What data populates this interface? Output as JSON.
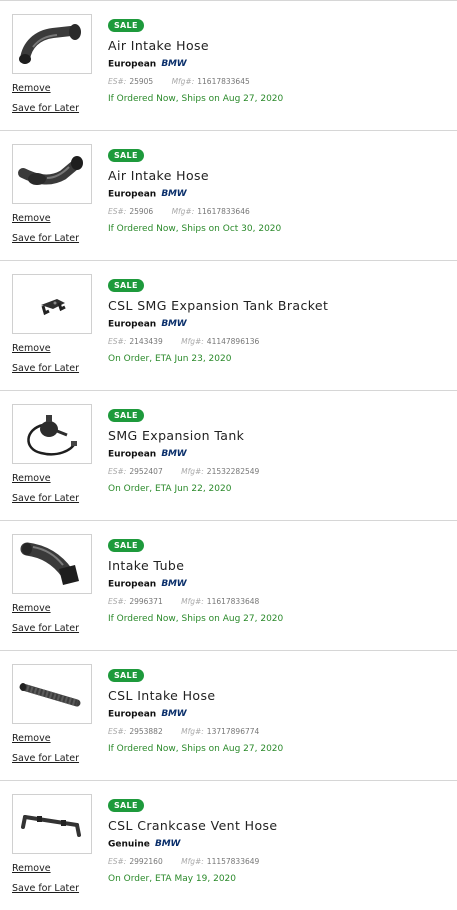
{
  "labels": {
    "sale": "SALE",
    "remove": "Remove",
    "save_for_later": "Save for Later",
    "es_label": "ES#:",
    "mfg_label": "Mfg#:"
  },
  "brand_logo_text": "BMW",
  "colors": {
    "sale_badge": "#1e9a3c",
    "ship_text": "#2b8a2b"
  },
  "items": [
    {
      "title": "Air Intake Hose",
      "brand": "European",
      "es": "25905",
      "mfg": "11617833645",
      "ship": "If Ordered Now, Ships on Aug 27, 2020",
      "image": "air-intake-hose-image"
    },
    {
      "title": "Air Intake Hose",
      "brand": "European",
      "es": "25906",
      "mfg": "11617833646",
      "ship": "If Ordered Now, Ships on Oct 30, 2020",
      "image": "air-intake-hose-image"
    },
    {
      "title": "CSL SMG Expansion Tank Bracket",
      "brand": "European",
      "es": "2143439",
      "mfg": "41147896136",
      "ship": "On Order, ETA Jun 23, 2020",
      "image": "bracket-image"
    },
    {
      "title": "SMG Expansion Tank",
      "brand": "European",
      "es": "2952407",
      "mfg": "21532282549",
      "ship": "On Order, ETA Jun 22, 2020",
      "image": "expansion-tank-image"
    },
    {
      "title": "Intake Tube",
      "brand": "European",
      "es": "2996371",
      "mfg": "11617833648",
      "ship": "If Ordered Now, Ships on Aug 27, 2020",
      "image": "intake-tube-image"
    },
    {
      "title": "CSL Intake Hose",
      "brand": "European",
      "es": "2953882",
      "mfg": "13717896774",
      "ship": "If Ordered Now, Ships on Aug 27, 2020",
      "image": "intake-hose-image"
    },
    {
      "title": "CSL Crankcase Vent Hose",
      "brand": "Genuine",
      "es": "2992160",
      "mfg": "11157833649",
      "ship": "On Order, ETA May 19, 2020",
      "image": "vent-hose-image"
    }
  ]
}
